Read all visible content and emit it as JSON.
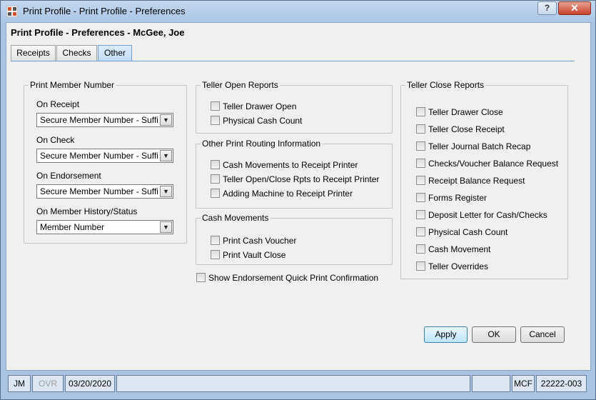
{
  "window": {
    "title": "Print Profile - Print Profile - Preferences",
    "help_label": "?",
    "close_label": "✕"
  },
  "heading": "Print Profile - Preferences - McGee, Joe",
  "tabs": [
    {
      "label": "Receipts",
      "active": false
    },
    {
      "label": "Checks",
      "active": false
    },
    {
      "label": "Other",
      "active": true
    }
  ],
  "print_member_number": {
    "title": "Print Member Number",
    "fields": [
      {
        "label": "On Receipt",
        "value": "Secure Member Number - Suffix"
      },
      {
        "label": "On Check",
        "value": "Secure Member Number - Suffix"
      },
      {
        "label": "On Endorsement",
        "value": "Secure Member Number - Suffix"
      },
      {
        "label": "On Member History/Status",
        "value": "Member Number"
      }
    ]
  },
  "teller_open_reports": {
    "title": "Teller Open Reports",
    "items": [
      {
        "label": "Teller Drawer Open",
        "checked": false
      },
      {
        "label": "Physical Cash Count",
        "checked": false
      }
    ]
  },
  "other_routing": {
    "title": "Other Print Routing Information",
    "items": [
      {
        "label": "Cash Movements to Receipt Printer",
        "checked": false
      },
      {
        "label": "Teller Open/Close Rpts to Receipt Printer",
        "checked": false
      },
      {
        "label": "Adding Machine to Receipt Printer",
        "checked": false
      }
    ]
  },
  "cash_movements": {
    "title": "Cash Movements",
    "items": [
      {
        "label": "Print Cash Voucher",
        "checked": false
      },
      {
        "label": "Print Vault Close",
        "checked": false
      }
    ]
  },
  "endorsement_confirm": {
    "label": "Show Endorsement Quick Print Confirmation",
    "checked": false
  },
  "teller_close_reports": {
    "title": "Teller Close Reports",
    "items": [
      {
        "label": "Teller Drawer Close",
        "checked": false
      },
      {
        "label": "Teller Close Receipt",
        "checked": false
      },
      {
        "label": "Teller Journal Batch Recap",
        "checked": false
      },
      {
        "label": "Checks/Voucher Balance Request",
        "checked": false
      },
      {
        "label": "Receipt Balance Request",
        "checked": false
      },
      {
        "label": "Forms Register",
        "checked": false
      },
      {
        "label": "Deposit Letter for Cash/Checks",
        "checked": false
      },
      {
        "label": "Physical Cash Count",
        "checked": false
      },
      {
        "label": "Cash Movement",
        "checked": false
      },
      {
        "label": "Teller Overrides",
        "checked": false
      }
    ]
  },
  "buttons": {
    "apply": "Apply",
    "ok": "OK",
    "cancel": "Cancel"
  },
  "status_bar": {
    "user": "JM",
    "ovr": "OVR",
    "date": "03/20/2020",
    "code": "MCF",
    "id": "22222-003"
  },
  "colors": {
    "titlebar": "#a9c6e6",
    "active_tab": "#c1dcf7",
    "close_button": "#c8402b"
  }
}
